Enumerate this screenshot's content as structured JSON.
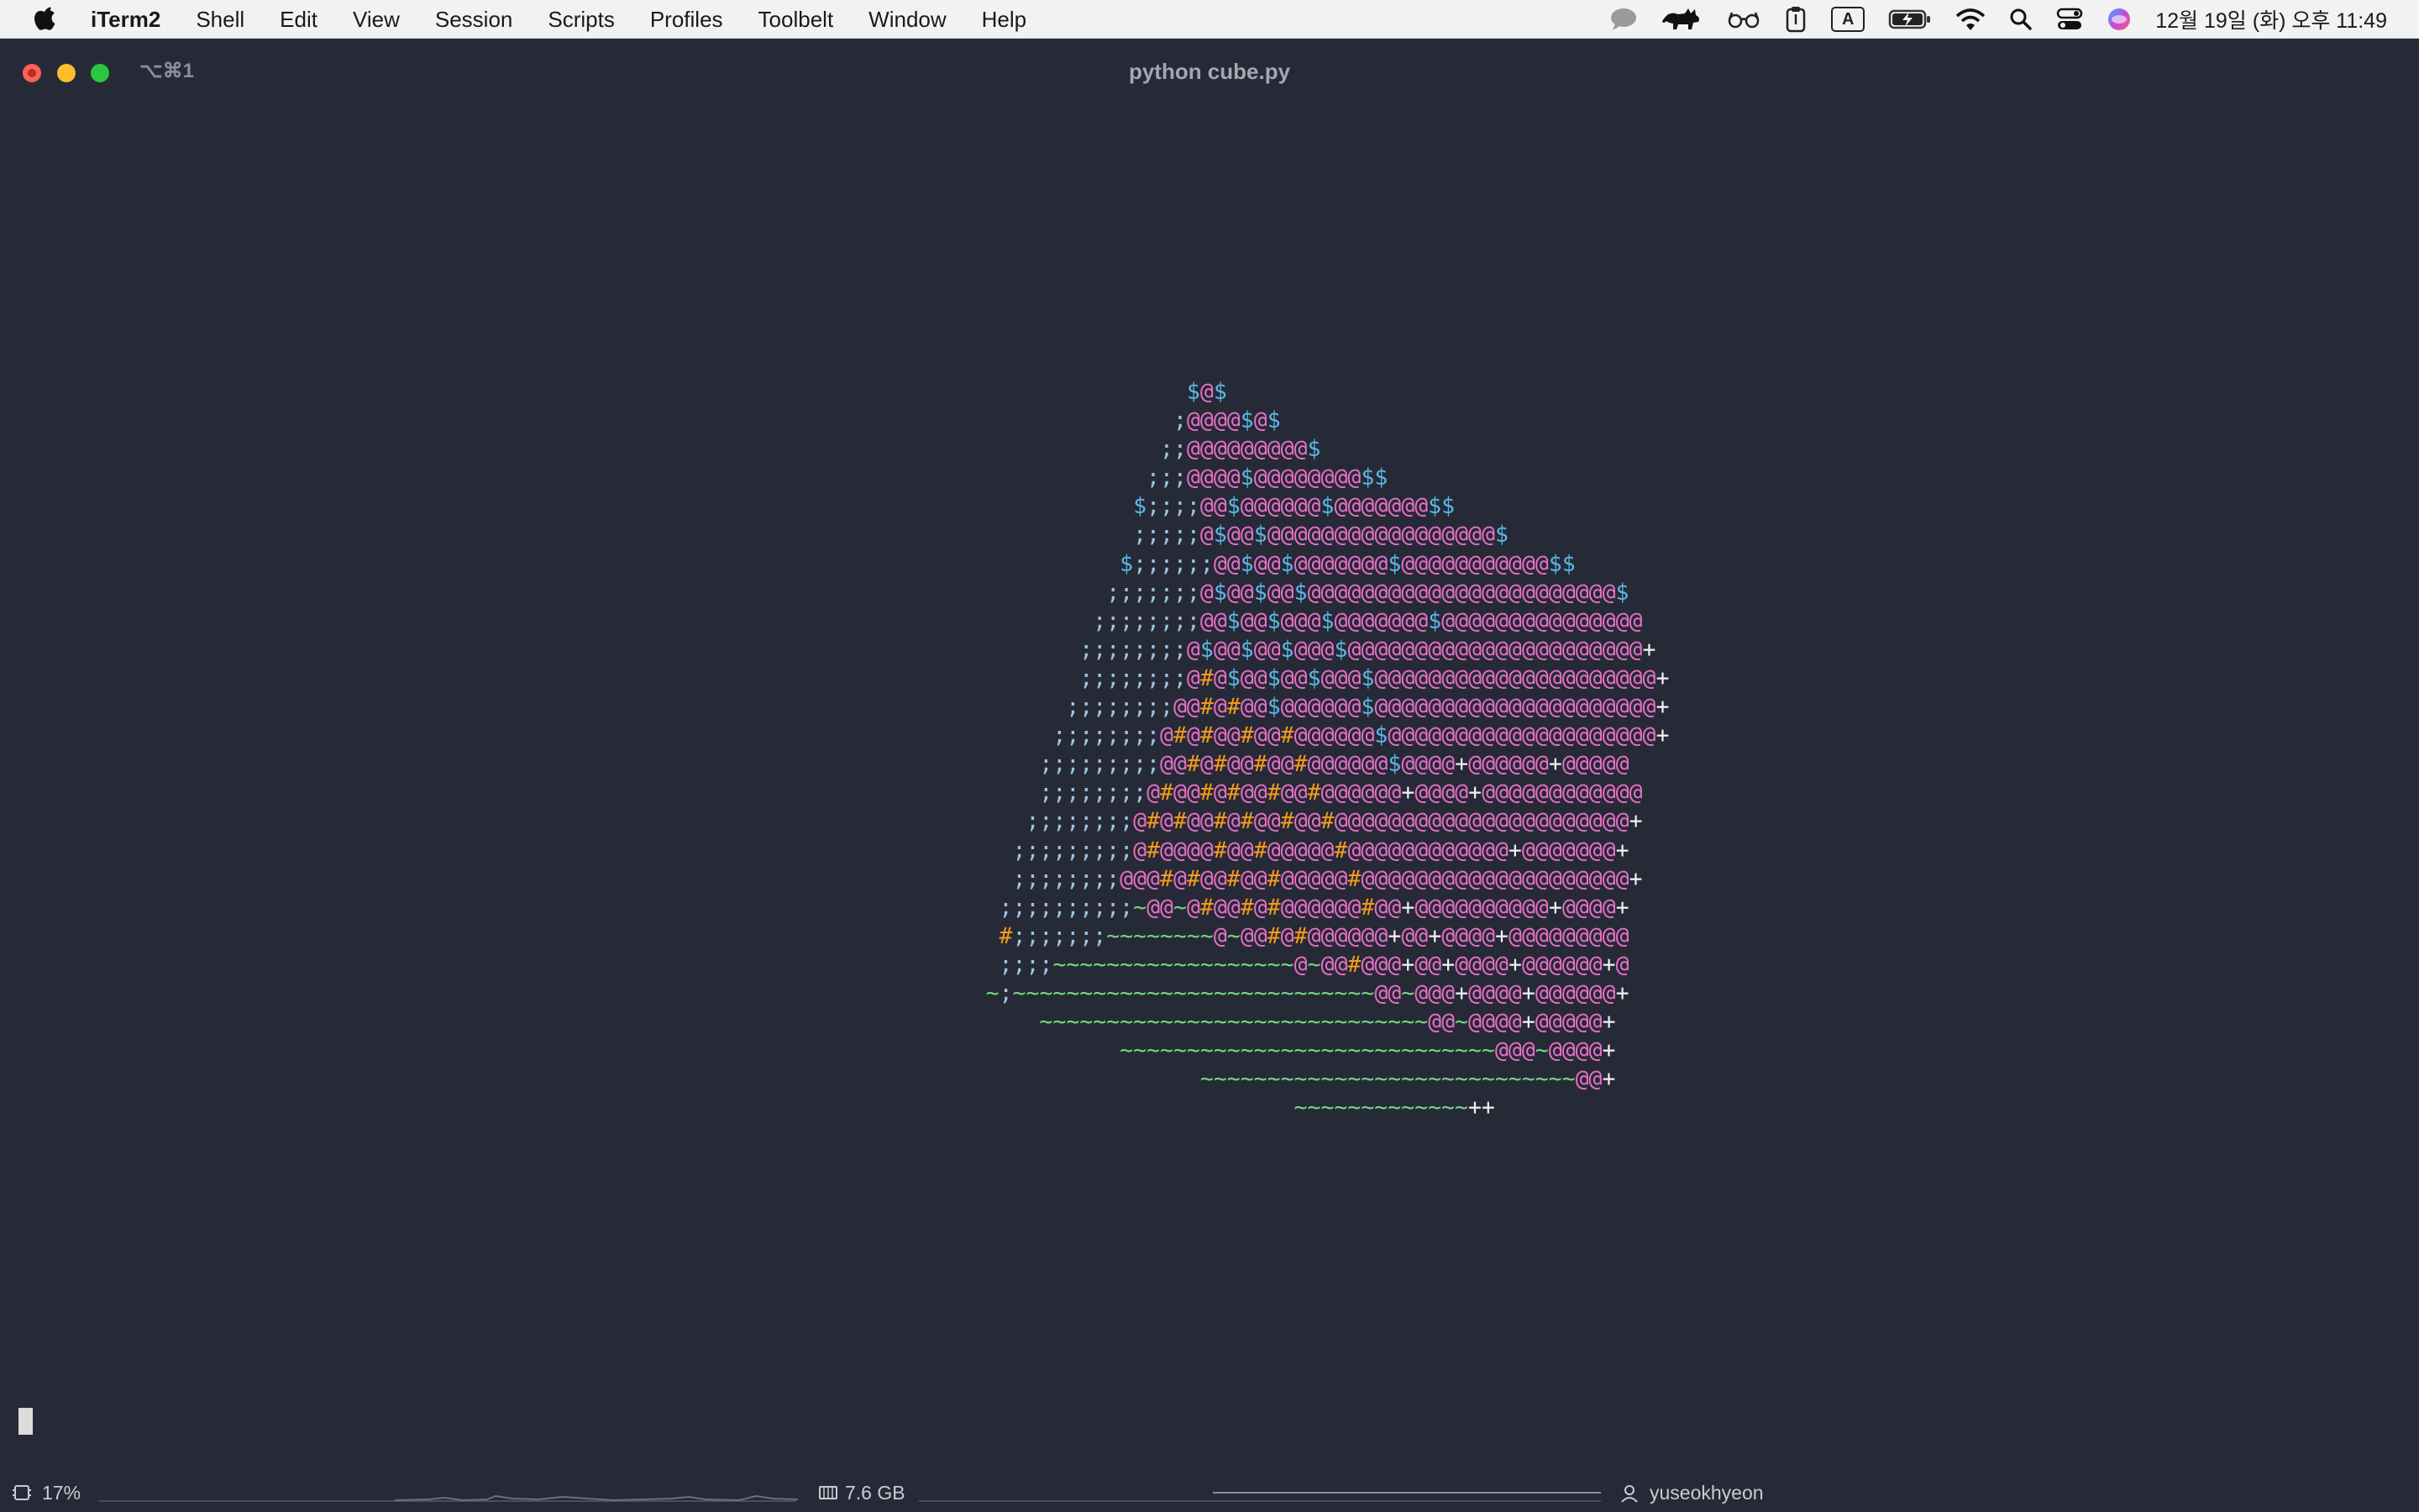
{
  "menubar": {
    "apple_icon": "apple-logo-icon",
    "app_name": "iTerm2",
    "items": [
      "Shell",
      "Edit",
      "View",
      "Session",
      "Scripts",
      "Profiles",
      "Toolbelt",
      "Window",
      "Help"
    ],
    "status_icons": [
      "chat-bubble-icon",
      "cat-icon",
      "glasses-icon",
      "clipboard-icon",
      "input-source-icon",
      "battery-charging-icon",
      "wifi-icon",
      "spotlight-search-icon",
      "control-center-icon",
      "siri-icon"
    ],
    "input_source_label": "A",
    "clock": "12월 19일 (화) 오후 11:49"
  },
  "window": {
    "shortcut": "⌥⌘1",
    "title": "python cube.py"
  },
  "terminal": {
    "art_colors": {
      "semicolon": "#9ec4e0",
      "at": "#ea6fc8",
      "dollar": "#5cb8e8",
      "hash": "#f59a1c",
      "tilde": "#72d67e",
      "plus": "#f2f2f2",
      "background": "#262a37"
    },
    "ascii_lines": [
      "                        $@$",
      "                       ;@@@@$@$",
      "                      ;;@@@@@@@@@$",
      "                     ;;;@@@@$@@@@@@@@$$",
      "                    $;;;;@@$@@@@@@$@@@@@@@$$",
      "                    ;;;;;@$@@$@@@@@@@@@@@@@@@@@$",
      "                   $;;;;;;@@$@@$@@@@@@@$@@@@@@@@@@@$$",
      "                  ;;;;;;;@$@@$@@$@@@@@@@@@@@@@@@@@@@@@@@$",
      "                 ;;;;;;;;@@$@@$@@@$@@@@@@@$@@@@@@@@@@@@@@@",
      "                ;;;;;;;;@$@@$@@$@@@$@@@@@@@@@@@@@@@@@@@@@@+",
      "                ;;;;;;;;@#@$@@$@@$@@@$@@@@@@@@@@@@@@@@@@@@@+",
      "               ;;;;;;;;@@#@#@@$@@@@@@$@@@@@@@@@@@@@@@@@@@@@+",
      "              ;;;;;;;;@#@#@@#@@#@@@@@@$@@@@@@@@@@@@@@@@@@@@+",
      "             ;;;;;;;;;@@#@#@@#@@#@@@@@@$@@@@+@@@@@@+@@@@@",
      "             ;;;;;;;;@#@@#@#@@#@@#@@@@@@+@@@@+@@@@@@@@@@@@",
      "            ;;;;;;;;@#@#@@#@#@@#@@#@@@@@@@@@@@@@@@@@@@@@@+",
      "           ;;;;;;;;;@#@@@@#@@#@@@@@#@@@@@@@@@@@@+@@@@@@@+",
      "           ;;;;;;;;@@@#@#@@#@@#@@@@@#@@@@@@@@@@@@@@@@@@@@+",
      "          ;;;;;;;;;;~@@~@#@@#@#@@@@@@#@@+@@@@@@@@@@+@@@@+",
      "          #;;;;;;;~~~~~~~~@~@@#@#@@@@@@+@@+@@@@+@@@@@@@@@",
      "          ;;;;~~~~~~~~~~~~~~~~~~@~@@#@@@+@@+@@@@+@@@@@@+@",
      "         ~;~~~~~~~~~~~~~~~~~~~~~~~~~~~@@~@@@+@@@@+@@@@@@+",
      "             ~~~~~~~~~~~~~~~~~~~~~~~~~~~~~@@~@@@@+@@@@@+",
      "                   ~~~~~~~~~~~~~~~~~~~~~~~~~~~~@@@~@@@@+",
      "                         ~~~~~~~~~~~~~~~~~~~~~~~~~~~~@@+",
      "                                ~~~~~~~~~~~~~++"
    ]
  },
  "statusbar": {
    "cpu_icon": "cpu-chip-icon",
    "cpu_percent": "17%",
    "memory_icon": "memory-icon",
    "memory": "7.6 GB",
    "user_icon": "user-icon",
    "username": "yuseokhyeon"
  }
}
